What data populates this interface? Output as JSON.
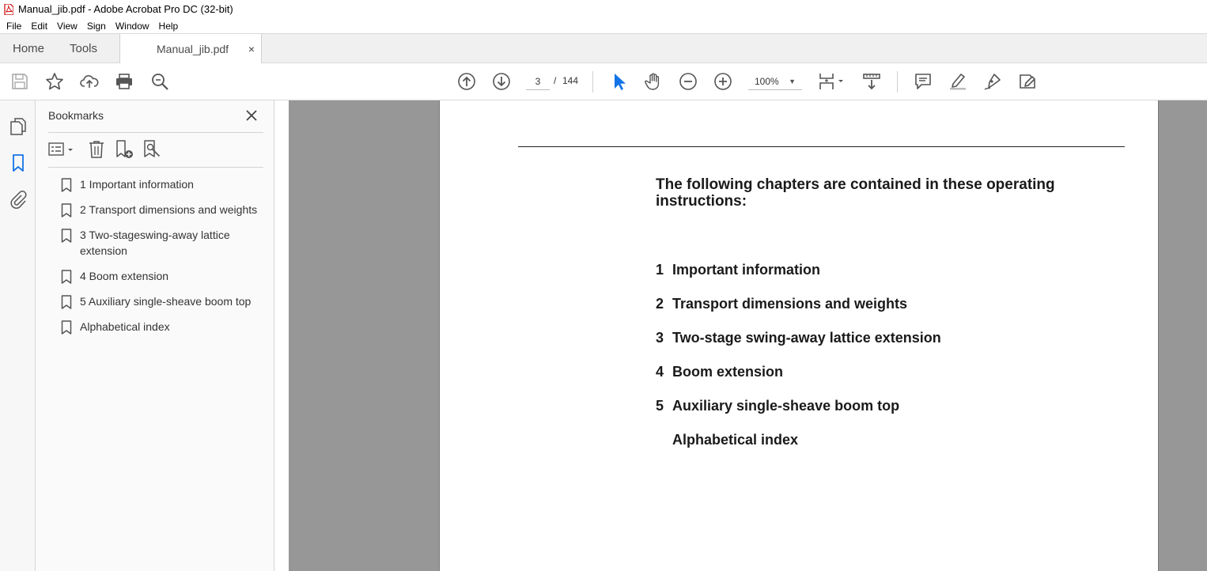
{
  "window": {
    "title": "Manual_jib.pdf - Adobe Acrobat Pro DC (32-bit)"
  },
  "menu": [
    "File",
    "Edit",
    "View",
    "Sign",
    "Window",
    "Help"
  ],
  "tabs": {
    "home": "Home",
    "tools": "Tools",
    "document": "Manual_jib.pdf",
    "close": "×"
  },
  "toolbar": {
    "current_page": "3",
    "separator": "/",
    "total_pages": "144",
    "zoom": "100%",
    "icons": [
      "save-icon",
      "star-icon",
      "cloud-upload-icon",
      "print-icon",
      "zoom-search-icon",
      "page-up-icon",
      "page-down-icon",
      "select-cursor-icon",
      "hand-icon",
      "zoom-out-icon",
      "zoom-in-icon",
      "page-layout-icon",
      "scroll-mode-icon",
      "comment-icon",
      "highlight-icon",
      "draw-icon",
      "fill-sign-icon"
    ]
  },
  "sidebar": {
    "title": "Bookmarks",
    "bookmarks": [
      "1 Important information",
      "2 Transport dimensions and weights",
      "3 Two-stageswing-away lattice extension",
      "4 Boom extension",
      "5 Auxiliary single-sheave boom top",
      "Alphabetical index"
    ]
  },
  "document": {
    "heading": "The following chapters are contained in these operating instructions:",
    "toc": [
      {
        "num": "1",
        "text": "Important information"
      },
      {
        "num": "2",
        "text": "Transport dimensions and weights"
      },
      {
        "num": "3",
        "text": "Two-stage swing-away lattice extension"
      },
      {
        "num": "4",
        "text": "Boom extension"
      },
      {
        "num": "5",
        "text": "Auxiliary single-sheave boom top"
      },
      {
        "num": "",
        "text": "Alphabetical index"
      }
    ]
  },
  "colors": {
    "accent": "#1473e6",
    "page_gray": "#979797"
  }
}
